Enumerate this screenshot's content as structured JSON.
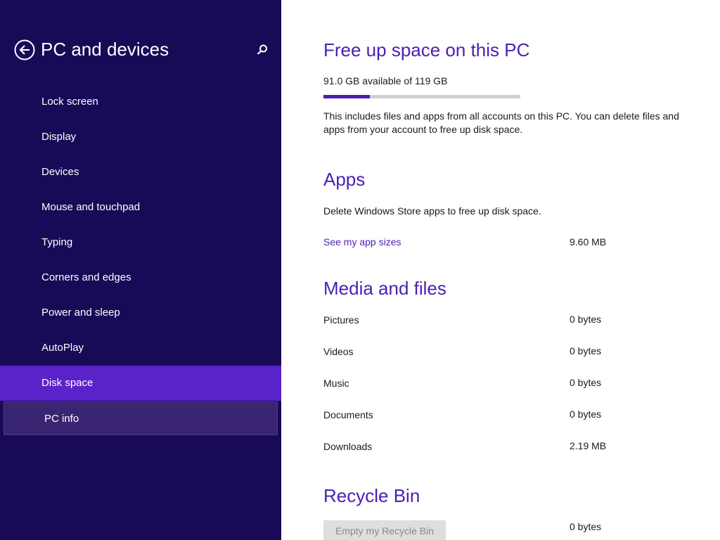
{
  "sidebar": {
    "title": "PC and devices",
    "back_icon": "back-arrow-circle-icon",
    "search_icon": "search-icon",
    "items": [
      {
        "label": "Lock screen"
      },
      {
        "label": "Display"
      },
      {
        "label": "Devices"
      },
      {
        "label": "Mouse and touchpad"
      },
      {
        "label": "Typing"
      },
      {
        "label": "Corners and edges"
      },
      {
        "label": "Power and sleep"
      },
      {
        "label": "AutoPlay"
      },
      {
        "label": "Disk space"
      },
      {
        "label": "PC info"
      }
    ],
    "selected_index": 8
  },
  "main": {
    "title": "Free up space on this PC",
    "storage_text": "91.0 GB available of 119 GB",
    "storage_used_fraction": 0.235,
    "description": "This includes files and apps from all accounts on this PC. You can delete files and apps from your account to free up disk space.",
    "apps": {
      "heading": "Apps",
      "description": "Delete Windows Store apps to free up disk space.",
      "link": "See my app sizes",
      "size": "9.60 MB"
    },
    "media": {
      "heading": "Media and files",
      "rows": [
        {
          "label": "Pictures",
          "value": "0 bytes"
        },
        {
          "label": "Videos",
          "value": "0 bytes"
        },
        {
          "label": "Music",
          "value": "0 bytes"
        },
        {
          "label": "Documents",
          "value": "0 bytes"
        },
        {
          "label": "Downloads",
          "value": "2.19 MB"
        }
      ]
    },
    "recycle": {
      "heading": "Recycle Bin",
      "button": "Empty my Recycle Bin",
      "size": "0 bytes"
    }
  },
  "colors": {
    "sidebar_bg": "#180a56",
    "selected_bg": "#5a22c9",
    "accent": "#4a1fb6"
  }
}
